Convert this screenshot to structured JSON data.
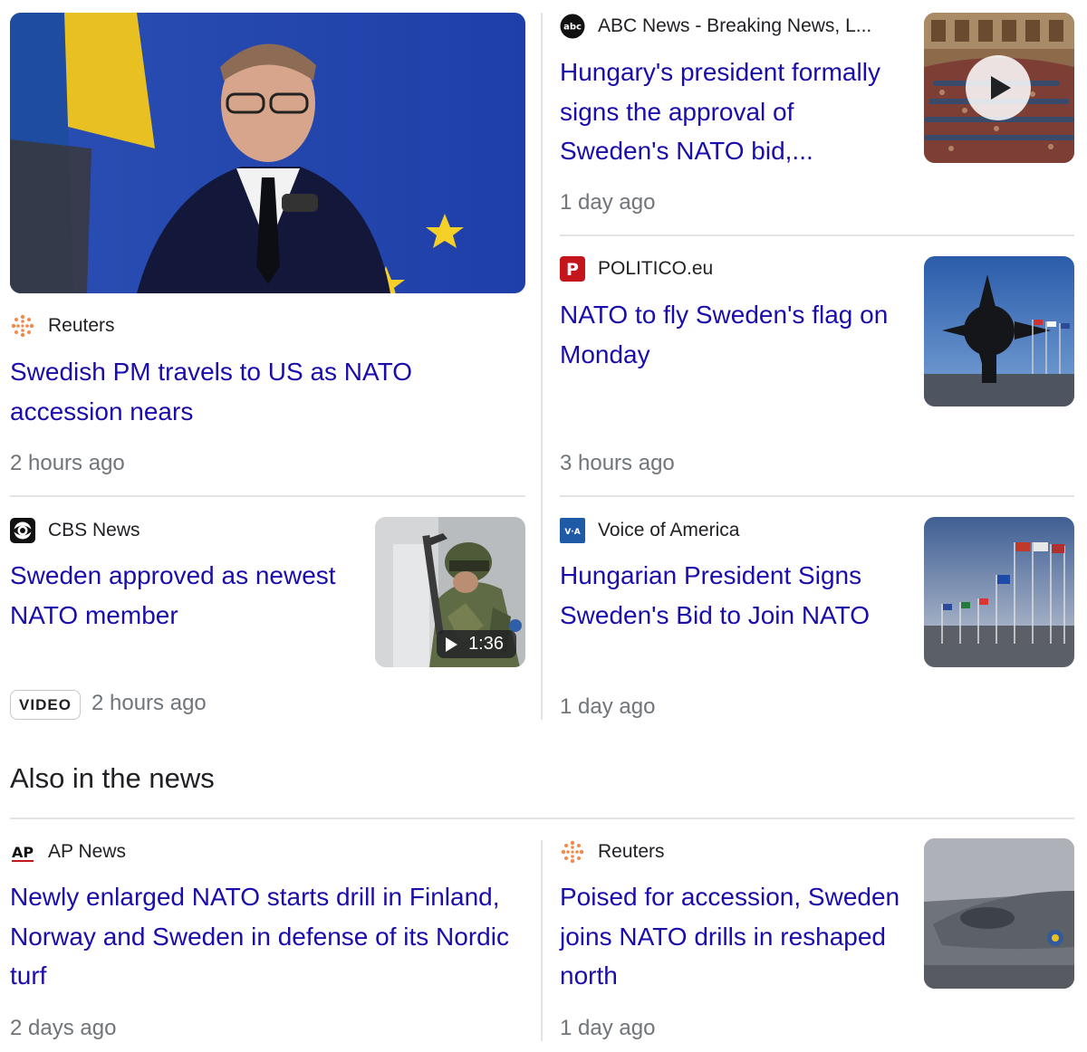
{
  "colors": {
    "link": "#1a0dab",
    "meta": "#70757a",
    "divider": "#e3e3e3"
  },
  "top_stories": [
    {
      "source": "Reuters",
      "source_icon": "reuters-logo-icon",
      "headline": "Swedish PM travels to US as NATO accession nears",
      "time": "2 hours ago",
      "image": "swedish-pm-speaking-at-podium"
    },
    {
      "source": "ABC News - Breaking News, L...",
      "source_icon": "abc-logo-icon",
      "headline": "Hungary's president formally signs the approval of Sweden's NATO bid,...",
      "time": "1 day ago",
      "image": "hungarian-parliament-video"
    },
    {
      "source": "POLITICO.eu",
      "source_icon": "politico-logo-icon",
      "headline": "NATO to fly Sweden's flag on Monday",
      "time": "3 hours ago",
      "image": "nato-star-sculpture"
    },
    {
      "source": "CBS News",
      "source_icon": "cbs-eye-logo-icon",
      "headline": "Sweden approved as newest NATO member",
      "badge": "VIDEO",
      "time": "2 hours ago",
      "duration": "1:36",
      "image": "soldier-in-camouflage"
    },
    {
      "source": "Voice of America",
      "source_icon": "voa-logo-icon",
      "headline": "Hungarian President Signs Sweden's Bid to Join NATO",
      "time": "1 day ago",
      "image": "nato-flags-on-poles"
    }
  ],
  "also_in_news": {
    "heading": "Also in the news",
    "items": [
      {
        "source": "AP News",
        "source_icon": "ap-logo-icon",
        "headline": "Newly enlarged NATO starts drill in Finland, Norway and Sweden in defense of its Nordic turf",
        "time": "2 days ago"
      },
      {
        "source": "Reuters",
        "source_icon": "reuters-logo-icon",
        "headline": "Poised for accession, Sweden joins NATO drills in reshaped north",
        "time": "1 day ago",
        "image": "fighter-jet-on-airfield"
      }
    ]
  }
}
